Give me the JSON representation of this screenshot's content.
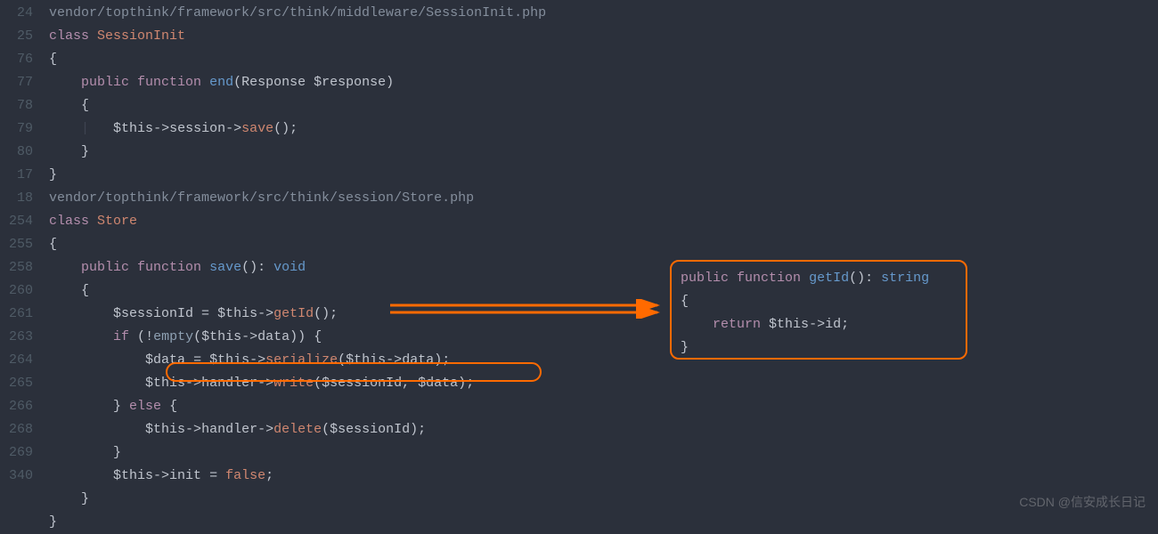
{
  "lines": [
    {
      "n": "",
      "html": [
        [
          "c-comment",
          "vendor/topthink/framework/src/think/middleware/SessionInit.php"
        ]
      ]
    },
    {
      "n": "24",
      "html": [
        [
          "c-keyword",
          "class"
        ],
        [
          "",
          " "
        ],
        [
          "c-class",
          "SessionInit"
        ]
      ]
    },
    {
      "n": "25",
      "html": [
        [
          "c-brace",
          "{"
        ]
      ]
    },
    {
      "n": "76",
      "html": [
        [
          "",
          "    "
        ],
        [
          "c-keyword",
          "public"
        ],
        [
          "",
          " "
        ],
        [
          "c-keyword",
          "function"
        ],
        [
          "",
          " "
        ],
        [
          "c-func-dec",
          "end"
        ],
        [
          "c-paren",
          "("
        ],
        [
          "c-type",
          "Response "
        ],
        [
          "c-var",
          "$response"
        ],
        [
          "c-paren",
          ")"
        ]
      ]
    },
    {
      "n": "77",
      "html": [
        [
          "",
          "    "
        ],
        [
          "c-brace",
          "{"
        ]
      ]
    },
    {
      "n": "78",
      "html": [
        [
          "",
          "    "
        ],
        [
          "c-guide",
          "|"
        ],
        [
          "",
          "   "
        ],
        [
          "c-var",
          "$this"
        ],
        [
          "c-arrow",
          "->"
        ],
        [
          "c-var",
          "session"
        ],
        [
          "c-arrow",
          "->"
        ],
        [
          "c-func",
          "save"
        ],
        [
          "c-paren",
          "()"
        ],
        [
          "c-punct",
          ";"
        ]
      ]
    },
    {
      "n": "79",
      "html": [
        [
          "",
          "    "
        ],
        [
          "c-brace",
          "}"
        ]
      ]
    },
    {
      "n": "80",
      "html": [
        [
          "c-brace",
          "}"
        ]
      ]
    },
    {
      "n": "",
      "html": [
        [
          "c-comment",
          "vendor/topthink/framework/src/think/session/Store.php"
        ]
      ]
    },
    {
      "n": "17",
      "html": [
        [
          "c-keyword",
          "class"
        ],
        [
          "",
          " "
        ],
        [
          "c-class",
          "Store"
        ]
      ]
    },
    {
      "n": "18",
      "html": [
        [
          "c-brace",
          "{"
        ]
      ]
    },
    {
      "n": "254",
      "html": [
        [
          "",
          "    "
        ],
        [
          "c-keyword",
          "public"
        ],
        [
          "",
          " "
        ],
        [
          "c-keyword",
          "function"
        ],
        [
          "",
          " "
        ],
        [
          "c-func-dec",
          "save"
        ],
        [
          "c-paren",
          "()"
        ],
        [
          "c-punct",
          ": "
        ],
        [
          "c-return-type",
          "void"
        ]
      ]
    },
    {
      "n": "255",
      "html": [
        [
          "",
          "    "
        ],
        [
          "c-brace",
          "{"
        ]
      ]
    },
    {
      "n": "258",
      "html": [
        [
          "",
          "        "
        ],
        [
          "c-var",
          "$sessionId"
        ],
        [
          "",
          " "
        ],
        [
          "c-punct",
          "="
        ],
        [
          "",
          " "
        ],
        [
          "c-var",
          "$this"
        ],
        [
          "c-arrow",
          "->"
        ],
        [
          "c-func",
          "getId"
        ],
        [
          "c-paren",
          "()"
        ],
        [
          "c-punct",
          ";"
        ]
      ]
    },
    {
      "n": "260",
      "html": [
        [
          "",
          "        "
        ],
        [
          "c-keyword",
          "if"
        ],
        [
          "",
          " "
        ],
        [
          "c-paren",
          "("
        ],
        [
          "c-punct",
          "!"
        ],
        [
          "c-builtin",
          "empty"
        ],
        [
          "c-paren",
          "("
        ],
        [
          "c-var",
          "$this"
        ],
        [
          "c-arrow",
          "->"
        ],
        [
          "c-var",
          "data"
        ],
        [
          "c-paren",
          "))"
        ],
        [
          "",
          " "
        ],
        [
          "c-brace",
          "{"
        ]
      ]
    },
    {
      "n": "261",
      "html": [
        [
          "",
          "            "
        ],
        [
          "c-var",
          "$data"
        ],
        [
          "",
          " "
        ],
        [
          "c-punct",
          "="
        ],
        [
          "",
          " "
        ],
        [
          "c-var",
          "$this"
        ],
        [
          "c-arrow",
          "->"
        ],
        [
          "c-func",
          "serialize"
        ],
        [
          "c-paren",
          "("
        ],
        [
          "c-var",
          "$this"
        ],
        [
          "c-arrow",
          "->"
        ],
        [
          "c-var",
          "data"
        ],
        [
          "c-paren",
          ")"
        ],
        [
          "c-punct",
          ";"
        ]
      ]
    },
    {
      "n": "263",
      "html": [
        [
          "",
          "            "
        ],
        [
          "c-var",
          "$this"
        ],
        [
          "c-arrow",
          "->"
        ],
        [
          "c-var",
          "handler"
        ],
        [
          "c-arrow",
          "->"
        ],
        [
          "c-func",
          "write"
        ],
        [
          "c-paren",
          "("
        ],
        [
          "c-var",
          "$sessionId"
        ],
        [
          "c-punct",
          ", "
        ],
        [
          "c-var",
          "$data"
        ],
        [
          "c-paren",
          ")"
        ],
        [
          "c-punct",
          ";"
        ]
      ]
    },
    {
      "n": "264",
      "html": [
        [
          "",
          "        "
        ],
        [
          "c-brace",
          "}"
        ],
        [
          "",
          " "
        ],
        [
          "c-keyword",
          "else"
        ],
        [
          "",
          " "
        ],
        [
          "c-brace",
          "{"
        ]
      ]
    },
    {
      "n": "265",
      "html": [
        [
          "",
          "            "
        ],
        [
          "c-var",
          "$this"
        ],
        [
          "c-arrow",
          "->"
        ],
        [
          "c-var",
          "handler"
        ],
        [
          "c-arrow",
          "->"
        ],
        [
          "c-func",
          "delete"
        ],
        [
          "c-paren",
          "("
        ],
        [
          "c-var",
          "$sessionId"
        ],
        [
          "c-paren",
          ")"
        ],
        [
          "c-punct",
          ";"
        ]
      ]
    },
    {
      "n": "266",
      "html": [
        [
          "",
          "        "
        ],
        [
          "c-brace",
          "}"
        ]
      ]
    },
    {
      "n": "268",
      "html": [
        [
          "",
          "        "
        ],
        [
          "c-var",
          "$this"
        ],
        [
          "c-arrow",
          "->"
        ],
        [
          "c-var",
          "init"
        ],
        [
          "",
          " "
        ],
        [
          "c-punct",
          "="
        ],
        [
          "",
          " "
        ],
        [
          "c-bool",
          "false"
        ],
        [
          "c-punct",
          ";"
        ]
      ]
    },
    {
      "n": "269",
      "html": [
        [
          "",
          "    "
        ],
        [
          "c-brace",
          "}"
        ]
      ]
    },
    {
      "n": "340",
      "html": [
        [
          "c-brace",
          "}"
        ]
      ]
    }
  ],
  "callout": [
    [
      [
        "c-keyword",
        "public"
      ],
      [
        "",
        " "
      ],
      [
        "c-keyword",
        "function"
      ],
      [
        "",
        " "
      ],
      [
        "c-func-dec",
        "getId"
      ],
      [
        "c-paren",
        "()"
      ],
      [
        "c-punct",
        ": "
      ],
      [
        "c-return-type",
        "string"
      ]
    ],
    [
      [
        "c-brace",
        "{"
      ]
    ],
    [
      [
        "",
        "    "
      ],
      [
        "c-keyword",
        "return"
      ],
      [
        "",
        " "
      ],
      [
        "c-var",
        "$this"
      ],
      [
        "c-arrow",
        "->"
      ],
      [
        "c-var",
        "id"
      ],
      [
        "c-punct",
        ";"
      ]
    ],
    [
      [
        "c-brace",
        "}"
      ]
    ]
  ],
  "watermark": "CSDN @信安成长日记",
  "colors": {
    "bg": "#2b303b",
    "annotation": "#ff6a00"
  }
}
